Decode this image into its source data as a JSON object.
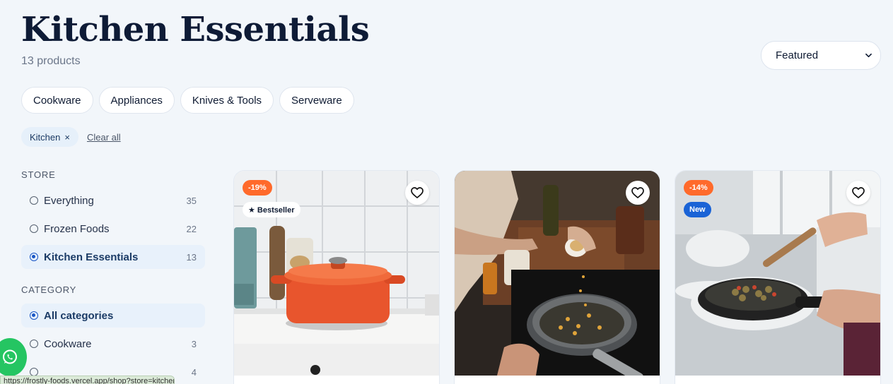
{
  "page": {
    "title": "Kitchen Essentials",
    "count_text": "13 products"
  },
  "sort": {
    "selected": "Featured"
  },
  "chips": [
    {
      "label": "Cookware"
    },
    {
      "label": "Appliances"
    },
    {
      "label": "Knives & Tools"
    },
    {
      "label": "Serveware"
    }
  ],
  "active_filters": {
    "pill_label": "Kitchen",
    "remove_glyph": "×",
    "clear_label": "Clear all"
  },
  "store_filter": {
    "title": "STORE",
    "options": [
      {
        "label": "Everything",
        "count": "35",
        "selected": false
      },
      {
        "label": "Frozen Foods",
        "count": "22",
        "selected": false
      },
      {
        "label": "Kitchen Essentials",
        "count": "13",
        "selected": true
      }
    ]
  },
  "category_filter": {
    "title": "CATEGORY",
    "options": [
      {
        "label": "All categories",
        "count": "",
        "selected": true
      },
      {
        "label": "Cookware",
        "count": "3",
        "selected": false
      },
      {
        "label": "",
        "count": "4",
        "selected": false
      }
    ]
  },
  "status_bar": {
    "url": "https://frostly-foods.vercel.app/shop?store=kitchen"
  },
  "products": [
    {
      "discount": "-19%",
      "badge": "★ Bestseller",
      "badge_type": "best"
    },
    {
      "discount": "",
      "badge": "",
      "badge_type": ""
    },
    {
      "discount": "-14%",
      "badge": "New",
      "badge_type": "new"
    }
  ],
  "colors": {
    "accent_orange": "#ff6a2b",
    "accent_blue": "#1a63d6",
    "whatsapp_green": "#25c562",
    "background": "#f2f6fa"
  },
  "icons": {
    "favorite": "heart-icon",
    "sort": "chevron-down-icon",
    "chat": "whatsapp-icon"
  }
}
